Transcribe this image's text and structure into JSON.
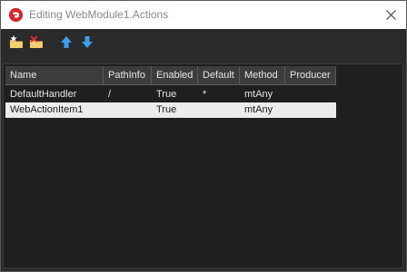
{
  "window": {
    "title": "Editing WebModule1.Actions"
  },
  "icons": {
    "app": "delphi-app-icon",
    "close": "close-icon",
    "add": "add-folder-icon",
    "delete": "delete-folder-icon",
    "up": "arrow-up-icon",
    "down": "arrow-down-icon"
  },
  "grid": {
    "columns": [
      "Name",
      "PathInfo",
      "Enabled",
      "Default",
      "Method",
      "Producer"
    ],
    "rows": [
      {
        "name": "DefaultHandler",
        "pathinfo": "/",
        "enabled": "True",
        "default": "*",
        "method": "mtAny",
        "producer": ""
      },
      {
        "name": "WebActionItem1",
        "pathinfo": "",
        "enabled": "True",
        "default": "",
        "method": "mtAny",
        "producer": ""
      }
    ],
    "selected_row": 1
  },
  "colors": {
    "titlebar": "#ffffff",
    "window_bg": "#2b2b2b",
    "grid_bg": "#1f1f1f",
    "header_bg": "#3c3c3c",
    "selected_row": "#ececec",
    "accent_blue": "#3aa0f0",
    "icon_yellow": "#e8b64a",
    "icon_red": "#d8262d"
  }
}
